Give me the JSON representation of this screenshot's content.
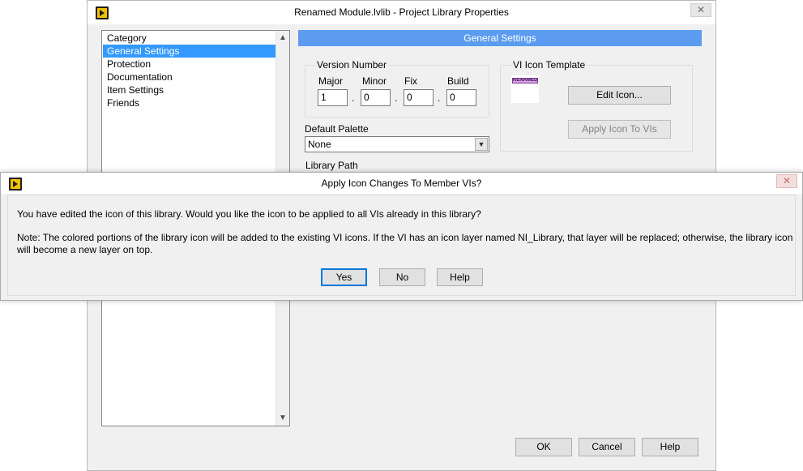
{
  "main_window": {
    "title": "Renamed Module.lvlib - Project Library Properties",
    "close_glyph": "✕",
    "categories": {
      "header": "Category",
      "items": [
        "General Settings",
        "Protection",
        "Documentation",
        "Item Settings",
        "Friends"
      ],
      "selected": "General Settings"
    },
    "panel_title": "General Settings",
    "version": {
      "label": "Version Number",
      "major_label": "Major",
      "minor_label": "Minor",
      "fix_label": "Fix",
      "build_label": "Build",
      "major": "1",
      "minor": "0",
      "fix": "0",
      "build": "0",
      "separator": "."
    },
    "icon_template": {
      "label": "VI Icon Template",
      "icon_text": "RENAMED",
      "edit_button": "Edit Icon...",
      "apply_button": "Apply Icon To VIs"
    },
    "default_palette": {
      "label": "Default Palette",
      "value": "None"
    },
    "library_path_label": "Library Path",
    "buttons": {
      "ok": "OK",
      "cancel": "Cancel",
      "help": "Help"
    }
  },
  "dialog": {
    "title": "Apply Icon Changes To Member VIs?",
    "close_glyph": "✕",
    "message": "You have edited the icon of this library. Would you like the icon to be applied to all VIs already in this library?",
    "note_line1": "Note: The colored portions of the library icon will be added to the existing VI icons. If the VI has an icon layer named NI_Library, that layer will be replaced; otherwise, the library icon",
    "note_line2": "will become a new layer on top.",
    "buttons": {
      "yes": "Yes",
      "no": "No",
      "help": "Help"
    }
  },
  "colors": {
    "header_blue": "#5b9cf0",
    "selection_blue": "#3399ff",
    "icon_band": "#d9a0e8"
  },
  "icons": {
    "app_icon": "labview-app-icon",
    "scroll_up": "chevron-up-icon",
    "scroll_down": "chevron-down-icon",
    "dropdown": "chevron-down-icon"
  }
}
